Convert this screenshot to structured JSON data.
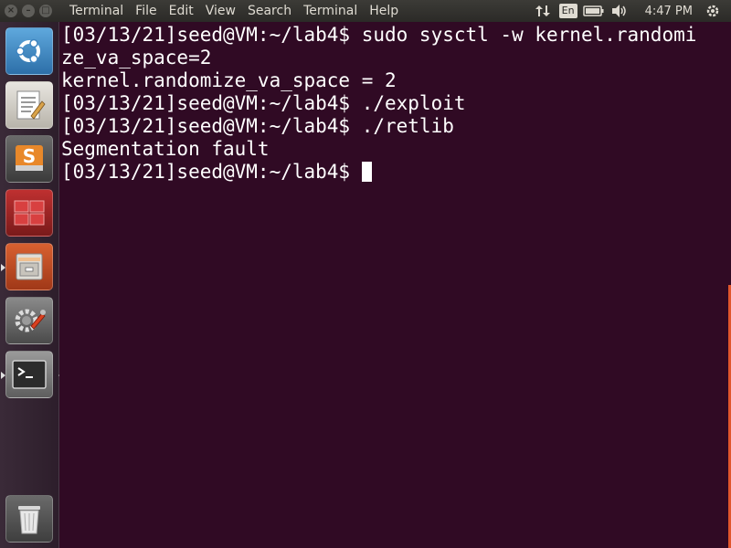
{
  "window_buttons": {
    "close": "×",
    "minimize": "–",
    "maximize": "□"
  },
  "menubar": {
    "items": [
      "Terminal",
      "File",
      "Edit",
      "View",
      "Search",
      "Terminal",
      "Help"
    ]
  },
  "indicators": {
    "keyboard_lang": "En",
    "clock": "4:47 PM"
  },
  "launcher": {
    "items": [
      {
        "name": "dash-home"
      },
      {
        "name": "text-editor"
      },
      {
        "name": "sublime-text"
      },
      {
        "name": "workspace-switcher"
      },
      {
        "name": "file-manager"
      },
      {
        "name": "system-settings"
      },
      {
        "name": "terminal"
      },
      {
        "name": "trash"
      }
    ]
  },
  "terminal": {
    "lines": [
      "[03/13/21]seed@VM:~/lab4$ sudo sysctl -w kernel.randomi",
      "ze_va_space=2",
      "kernel.randomize_va_space = 2",
      "[03/13/21]seed@VM:~/lab4$ ./exploit",
      "[03/13/21]seed@VM:~/lab4$ ./retlib",
      "Segmentation fault",
      "[03/13/21]seed@VM:~/lab4$ "
    ]
  },
  "colors": {
    "terminal_bg": "#300a24",
    "terminal_fg": "#ffffff",
    "panel_bg": "#3c3b37",
    "accent": "#e0562c"
  }
}
